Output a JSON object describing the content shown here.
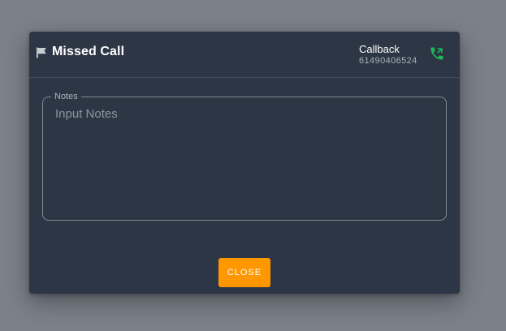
{
  "dialog": {
    "title": "Missed Call",
    "title_icon": "flag-icon",
    "callback": {
      "label": "Callback",
      "number": "61490406524",
      "icon": "phone-callback-icon",
      "icon_color": "#1db954"
    },
    "notes": {
      "legend": "Notes",
      "placeholder": "Input Notes",
      "value": ""
    },
    "close_label": "CLOSE",
    "close_color": "#ff9800"
  }
}
